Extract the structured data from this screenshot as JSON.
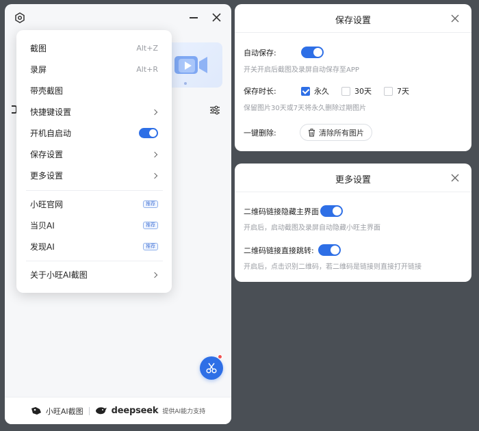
{
  "menu": {
    "items": [
      {
        "label": "截图",
        "shortcut": "Alt+Z"
      },
      {
        "label": "录屏",
        "shortcut": "Alt+R"
      },
      {
        "label": "带壳截图"
      },
      {
        "label": "快捷键设置"
      },
      {
        "label": "开机自启动",
        "toggle_on": true
      },
      {
        "label": "保存设置"
      },
      {
        "label": "更多设置"
      }
    ],
    "links": [
      {
        "label": "小旺官网",
        "badge": "推荐"
      },
      {
        "label": "当贝AI",
        "badge": "推荐"
      },
      {
        "label": "发现AI",
        "badge": "推荐"
      }
    ],
    "about": "关于小旺AI截图"
  },
  "footer": {
    "brand": "小旺AI截图",
    "partner": "deepseek",
    "support": "提供AI能力支持"
  },
  "save_settings": {
    "title": "保存设置",
    "auto_save_label": "自动保存:",
    "auto_save_on": true,
    "auto_save_hint": "开关开启后截图及录屏自动保存至APP",
    "duration_label": "保存时长:",
    "options": [
      {
        "label": "永久",
        "checked": true
      },
      {
        "label": "30天",
        "checked": false
      },
      {
        "label": "7天",
        "checked": false
      }
    ],
    "duration_hint": "保留图片30天或7天将永久删除过期图片",
    "delete_label": "一键删除:",
    "clear_button": "清除所有图片"
  },
  "more_settings": {
    "title": "更多设置",
    "hide_label": "二维码链接隐藏主界面",
    "hide_on": true,
    "hide_hint": "开启后，启动截图及录屏自动隐藏小旺主界面",
    "jump_label": "二维码链接直接跳转:",
    "jump_on": true,
    "jump_hint": "开启后，点击识别二维码，若二维码是链接则直接打开链接"
  },
  "colors": {
    "accent": "#2e6fe6",
    "background": "#4a4f55",
    "notification": "#f05252"
  }
}
